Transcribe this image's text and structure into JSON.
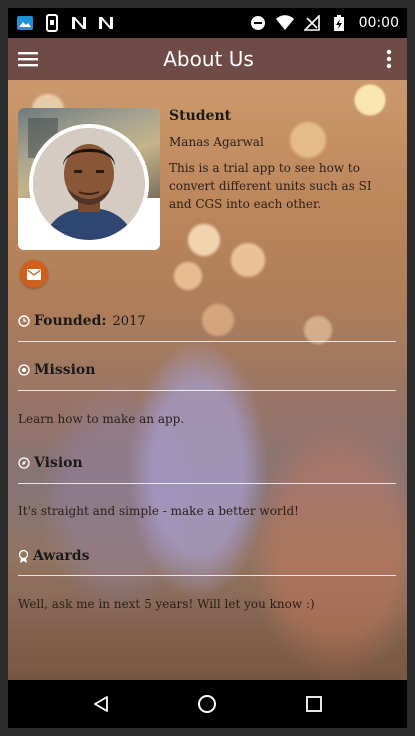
{
  "status_bar": {
    "time": "00:00",
    "left_icons": [
      "photo-notification-icon",
      "phone-notification-icon",
      "n-app-icon",
      "n-app-icon"
    ],
    "right_icons": [
      "do-not-disturb-icon",
      "wifi-icon",
      "no-signal-icon",
      "battery-charging-icon"
    ]
  },
  "app_bar": {
    "title": "About Us",
    "menu_icon": "hamburger-menu-icon",
    "more_icon": "more-vert-icon",
    "color": "#6e4b46"
  },
  "profile": {
    "role": "Student",
    "name": "Manas Agarwal",
    "description": "This is a trial app to see how to convert different units such as SI and CGS into each other.",
    "contact_icon": "email-icon",
    "accent": "#d0601e"
  },
  "sections": {
    "founded": {
      "label": "Founded:",
      "value": "2017",
      "icon": "clock-icon"
    },
    "mission": {
      "label": "Mission",
      "icon": "target-icon",
      "text": "Learn how to make an app."
    },
    "vision": {
      "label": "Vision",
      "icon": "compass-icon",
      "text": "It's straight and simple - make a better world!"
    },
    "awards": {
      "label": "Awards",
      "icon": "award-icon",
      "text": "Well, ask me in next 5 years! Will let you know :)"
    }
  },
  "nav_bar": {
    "buttons": [
      "back-icon",
      "home-icon",
      "recents-icon"
    ]
  }
}
